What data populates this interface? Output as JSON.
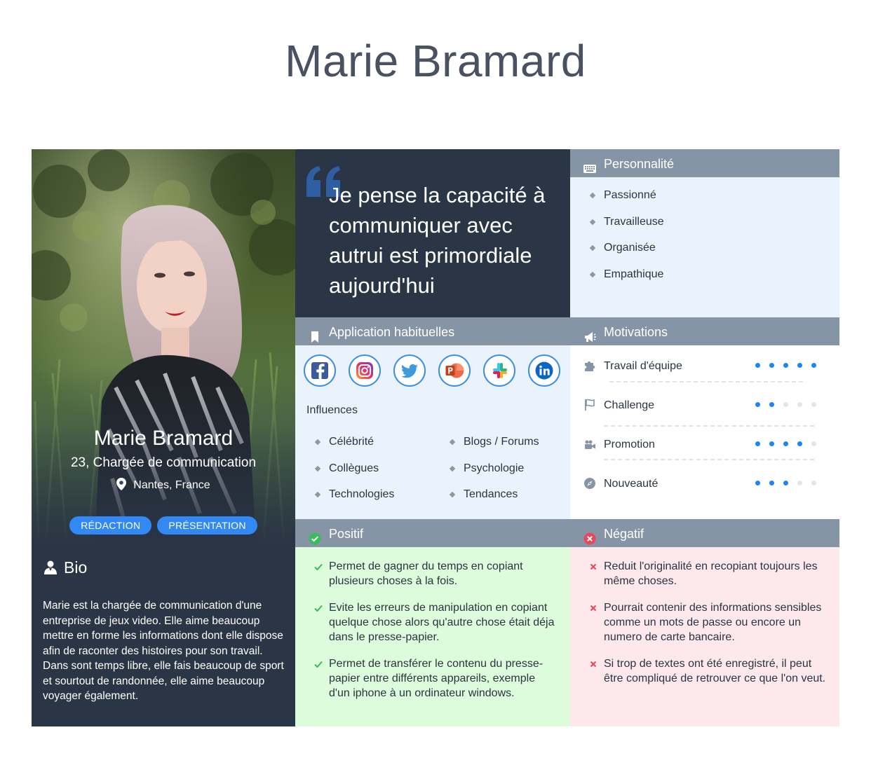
{
  "page": {
    "title": "Marie Bramard"
  },
  "profile": {
    "name": "Marie Bramard",
    "role": "23, Chargée de communication",
    "location": "Nantes, France",
    "tags": [
      "RÉDACTION",
      "PRÉSENTATION"
    ],
    "location_icon": "map-pin-icon",
    "photo": "portrait-photo"
  },
  "bio": {
    "title": "Bio",
    "icon": "user-icon",
    "text": "Marie est la chargée de communication d'une entreprise de jeux video. Elle aime beaucoup mettre en forme les informations dont elle dispose afin de raconter des histoires pour son travail. Dans sont temps libre, elle fais beaucoup de sport et sourtout de randonnée, elle aime beaucoup voyager également."
  },
  "quote": {
    "text": "Je pense la capacité à communiquer avec autrui est primordiale aujourd'hui"
  },
  "personality": {
    "title": "Personnalité",
    "icon": "keyboard-icon",
    "items": [
      "Passionné",
      "Travailleuse",
      "Organisée",
      "Empathique"
    ]
  },
  "applications": {
    "title": "Application habituelles",
    "icon": "bookmark-icon",
    "apps": [
      "facebook-icon",
      "instagram-icon",
      "twitter-icon",
      "powerpoint-icon",
      "slack-icon",
      "linkedin-icon"
    ],
    "influences_label": "Influences",
    "influences_left": [
      "Célébrité",
      "Collègues",
      "Technologies"
    ],
    "influences_right": [
      "Blogs / Forums",
      "Psychologie",
      "Tendances"
    ]
  },
  "motivations": {
    "title": "Motivations",
    "icon": "megaphone-icon",
    "items": [
      {
        "label": "Travail d'équipe",
        "level": 5,
        "icon": "puzzle-icon"
      },
      {
        "label": "Challenge",
        "level": 2,
        "icon": "flag-icon"
      },
      {
        "label": "Promotion",
        "level": 4,
        "icon": "video-camera-icon"
      },
      {
        "label": "Nouveauté",
        "level": 3,
        "icon": "compass-icon"
      }
    ],
    "max_level": 5
  },
  "positive": {
    "title": "Positif",
    "icon": "check-circle-icon",
    "items": [
      "Permet de gagner du temps en copiant plusieurs choses à la fois.",
      "Evite les erreurs de manipulation en copiant quelque chose alors qu'autre chose était déja dans le presse-papier.",
      "Permet de transférer le contenu du presse-papier entre différents appareils, exemple d'un iphone à un ordinateur windows."
    ]
  },
  "negative": {
    "title": "Négatif",
    "icon": "x-circle-icon",
    "items": [
      "Reduit l'originalité en recopiant toujours les même choses.",
      "Pourrait contenir des informations sensibles comme un mots de passe ou encore un numero de carte bancaire.",
      "Si trop de textes ont été enregistré, il peut être compliqué de retrouver ce que l'on veut."
    ]
  },
  "colors": {
    "dark": "#2a3546",
    "header": "#8695a6",
    "accent": "#3389f4",
    "light_blue": "#eaf3fb",
    "positive_bg": "#dcfcdc",
    "negative_bg": "#fde8ec"
  }
}
